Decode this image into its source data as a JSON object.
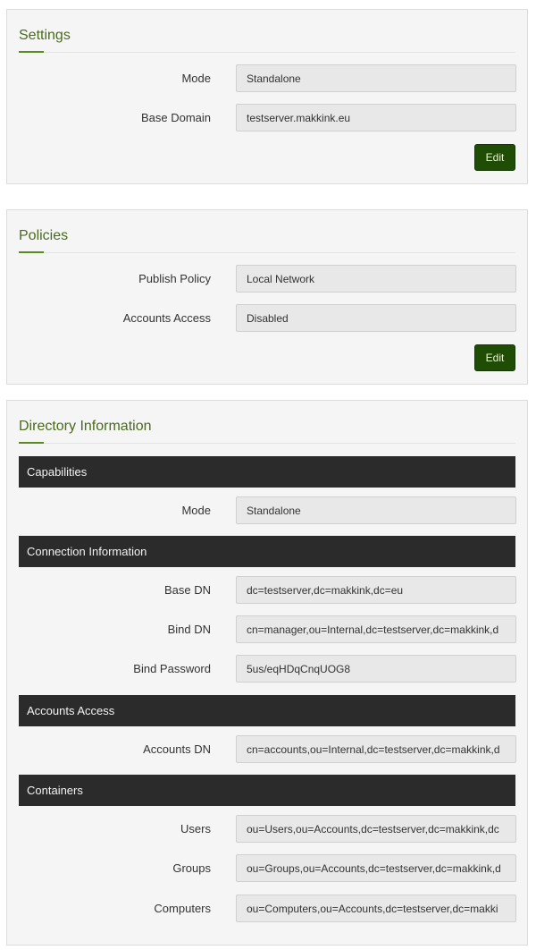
{
  "settings": {
    "title": "Settings",
    "rows": [
      {
        "label": "Mode",
        "value": "Standalone"
      },
      {
        "label": "Base Domain",
        "value": "testserver.makkink.eu"
      }
    ],
    "edit_label": "Edit"
  },
  "policies": {
    "title": "Policies",
    "rows": [
      {
        "label": "Publish Policy",
        "value": "Local Network"
      },
      {
        "label": "Accounts Access",
        "value": "Disabled"
      }
    ],
    "edit_label": "Edit"
  },
  "directory": {
    "title": "Directory Information",
    "capabilities": {
      "header": "Capabilities",
      "rows": [
        {
          "label": "Mode",
          "value": "Standalone"
        }
      ]
    },
    "connection": {
      "header": "Connection Information",
      "rows": [
        {
          "label": "Base DN",
          "value": "dc=testserver,dc=makkink,dc=eu"
        },
        {
          "label": "Bind DN",
          "value": "cn=manager,ou=Internal,dc=testserver,dc=makkink,d"
        },
        {
          "label": "Bind Password",
          "value": "5us/eqHDqCnqUOG8"
        }
      ]
    },
    "accounts_access": {
      "header": "Accounts Access",
      "rows": [
        {
          "label": "Accounts DN",
          "value": "cn=accounts,ou=Internal,dc=testserver,dc=makkink,d"
        }
      ]
    },
    "containers": {
      "header": "Containers",
      "rows": [
        {
          "label": "Users",
          "value": "ou=Users,ou=Accounts,dc=testserver,dc=makkink,dc"
        },
        {
          "label": "Groups",
          "value": "ou=Groups,ou=Accounts,dc=testserver,dc=makkink,d"
        },
        {
          "label": "Computers",
          "value": "ou=Computers,ou=Accounts,dc=testserver,dc=makki"
        }
      ]
    }
  },
  "colors": {
    "title_green": "#4a6b1e",
    "button_green": "#1f4d06",
    "section_bar": "#2b2b2b"
  }
}
